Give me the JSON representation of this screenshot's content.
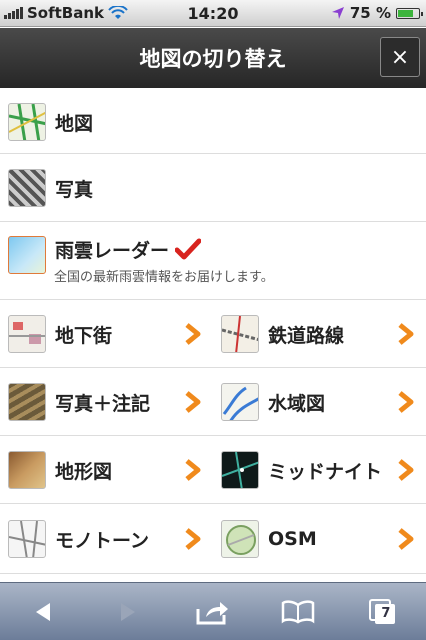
{
  "status_bar": {
    "carrier": "SoftBank",
    "time": "14:20",
    "battery": "75 %",
    "battery_level": 0.75
  },
  "header": {
    "title": "地図の切り替え",
    "close_label": "×"
  },
  "list": {
    "map": "地図",
    "photo": "写真",
    "radar": {
      "label": "雨雲レーダー",
      "sub": "全国の最新雨雲情報をお届けします。"
    },
    "underground": "地下街",
    "railway": "鉄道路線",
    "photo_annot": "写真＋注記",
    "water": "水域図",
    "terrain": "地形図",
    "midnight": "ミッドナイト",
    "monotone": "モノトーン",
    "osm": "OSM"
  },
  "toolbar": {
    "tabs_count": "7"
  },
  "colors": {
    "accent_arrow": "#f08a1c",
    "check": "#d8231e"
  }
}
